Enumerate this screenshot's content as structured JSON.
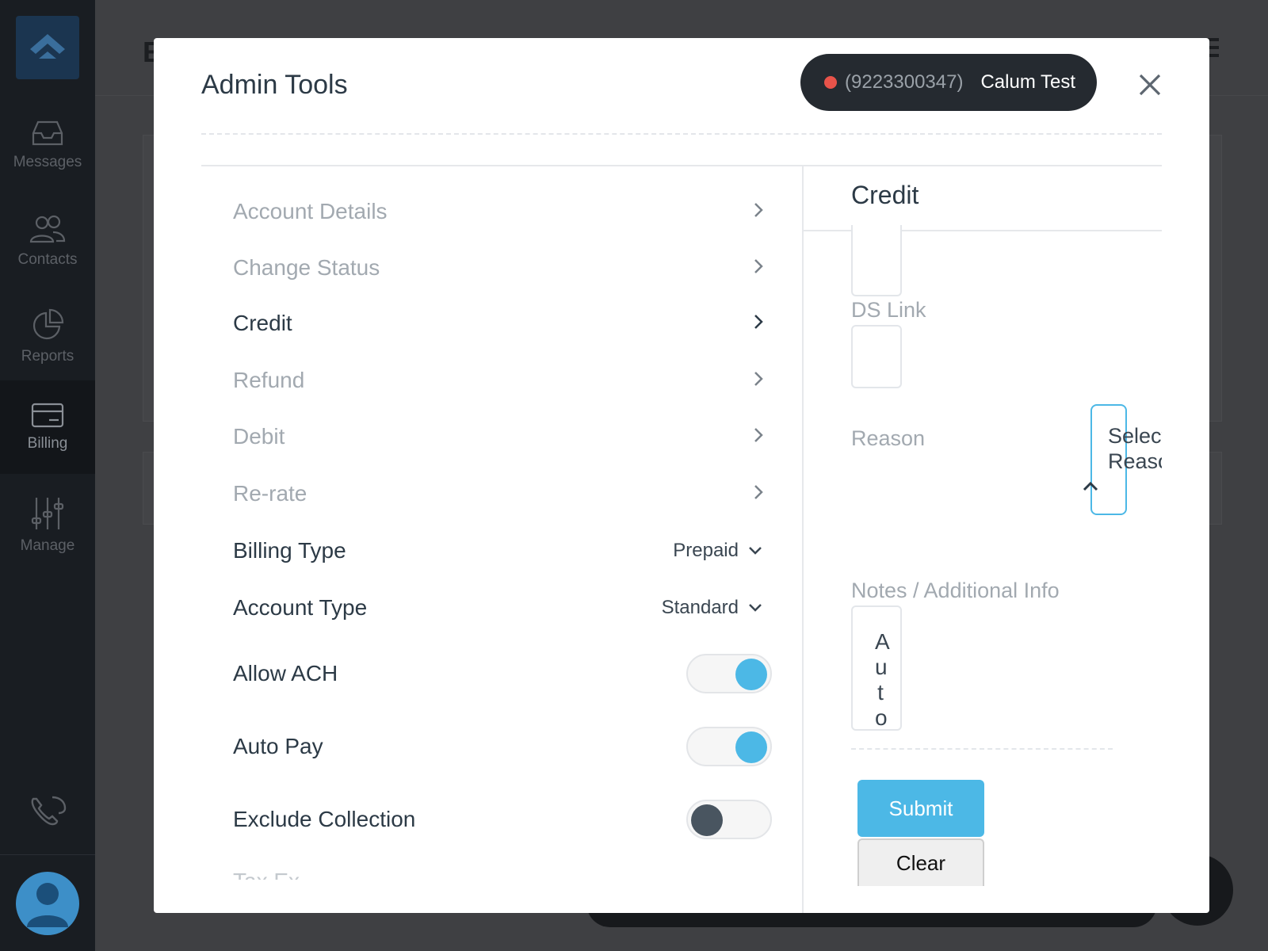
{
  "sidebar": {
    "items": [
      {
        "label": "Messages",
        "icon": "inbox-icon"
      },
      {
        "label": "Contacts",
        "icon": "people-icon"
      },
      {
        "label": "Reports",
        "icon": "pie-chart-icon"
      },
      {
        "label": "Billing",
        "icon": "credit-card-icon",
        "active": true
      },
      {
        "label": "Manage",
        "icon": "sliders-icon"
      }
    ]
  },
  "background": {
    "title_fragment": "E"
  },
  "modal": {
    "title": "Admin Tools",
    "user_pill": {
      "phone": "(9223300347)",
      "name": "Calum Test",
      "status_color": "#e8534a"
    },
    "menu": [
      {
        "label": "Account Details"
      },
      {
        "label": "Change Status"
      },
      {
        "label": "Credit",
        "active": true
      },
      {
        "label": "Refund"
      },
      {
        "label": "Debit"
      },
      {
        "label": "Re-rate"
      }
    ],
    "settings": {
      "billing_type": {
        "label": "Billing Type",
        "value": "Prepaid"
      },
      "account_type": {
        "label": "Account Type",
        "value": "Standard"
      },
      "allow_ach": {
        "label": "Allow ACH",
        "on": true
      },
      "auto_pay": {
        "label": "Auto Pay",
        "on": true
      },
      "exclude_collection": {
        "label": "Exclude Collection",
        "on": false
      },
      "cut_off_label": "Tax Ex"
    },
    "panel": {
      "title": "Credit",
      "ds_link_label": "DS Link",
      "reason_label": "Reason",
      "reason_placeholder_line1": "Select",
      "reason_placeholder_line2": "Reason",
      "notes_label": "Notes / Additional Info",
      "notes_value": [
        "A",
        "u",
        "t",
        "o"
      ],
      "submit_label": "Submit",
      "clear_label": "Clear"
    },
    "colors": {
      "accent": "#4cb8e6",
      "toggle_off_knob": "#495560",
      "text_dark": "#2c3a46",
      "text_muted": "#a2a9b0"
    }
  }
}
